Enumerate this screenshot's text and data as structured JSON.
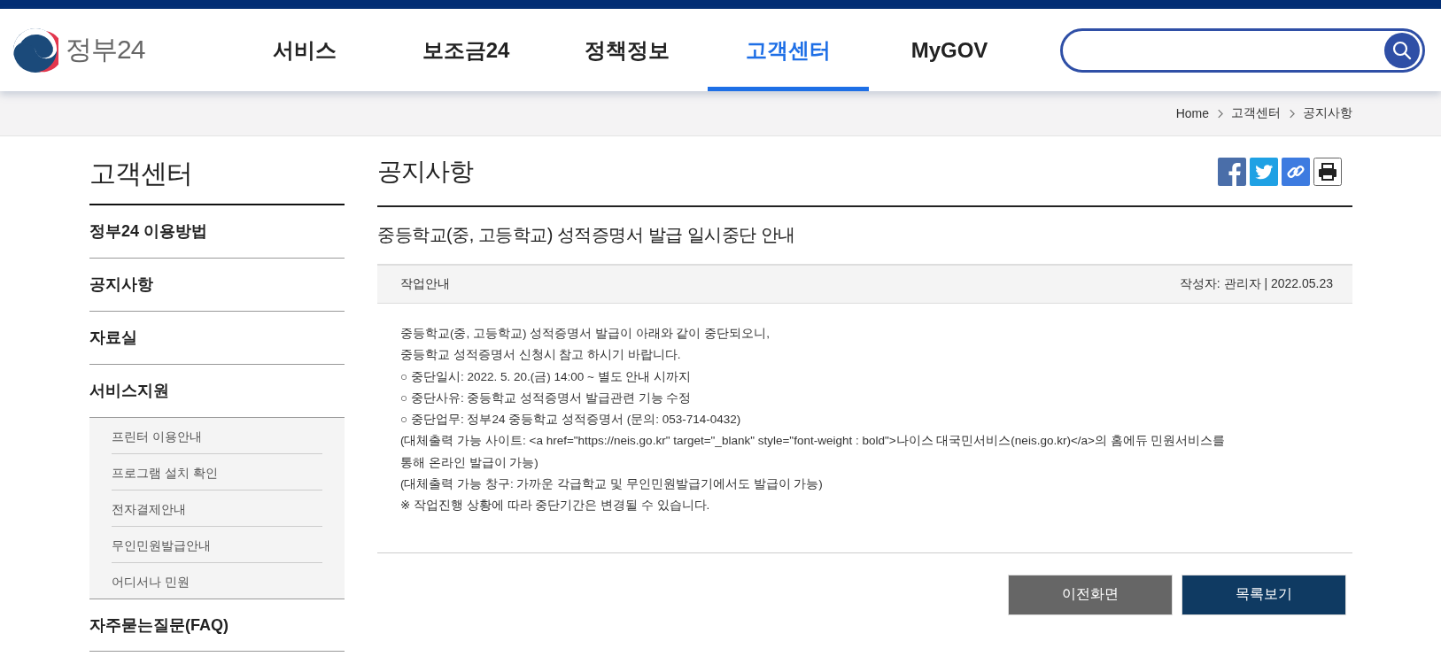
{
  "logo": {
    "text": "정부24"
  },
  "nav": [
    {
      "label": "서비스",
      "selected": false
    },
    {
      "label": "보조금24",
      "selected": false
    },
    {
      "label": "정책정보",
      "selected": false
    },
    {
      "label": "고객센터",
      "selected": true
    },
    {
      "label": "MyGOV",
      "selected": false
    }
  ],
  "breadcrumb": [
    "Home",
    "고객센터",
    "공지사항"
  ],
  "sidebar": {
    "title": "고객센터",
    "items": [
      {
        "label": "정부24 이용방법"
      },
      {
        "label": "공지사항"
      },
      {
        "label": "자료실"
      },
      {
        "label": "서비스지원",
        "children": [
          {
            "label": "프린터 이용안내"
          },
          {
            "label": "프로그램 설치 확인"
          },
          {
            "label": "전자결제안내"
          },
          {
            "label": "무인민원발급안내"
          },
          {
            "label": "어디서나 민원"
          }
        ]
      },
      {
        "label": "자주묻는질문(FAQ)"
      }
    ]
  },
  "page_title": "공지사항",
  "notice": {
    "title": "중등학교(중, 고등학교) 성적증명서 발급 일시중단 안내",
    "category": "작업안내",
    "meta": "작성자: 관리자 | 2022.05.23",
    "body": [
      "중등학교(중, 고등학교) 성적증명서 발급이 아래와 같이 중단되오니,",
      "중등학교 성적증명서 신청시 참고 하시기 바랍니다.",
      "○ 중단일시: 2022. 5. 20.(금) 14:00 ~ 별도 안내 시까지",
      "○ 중단사유: 중등학교 성적증명서 발급관련 기능 수정",
      "○ 중단업무: 정부24 중등학교 성적증명서 (문의: 053-714-0432)",
      "(대체출력 가능 사이트: <a href=\"https://neis.go.kr\" target=\"_blank\" style=\"font-weight : bold\">나이스 대국민서비스(neis.go.kr)</a>의 홈에듀 민원서비스를 통해 온라인 발급이 가능)",
      "(대체출력 가능 창구: 가까운 각급학교 및 무인민원발급기에서도 발급이 가능)",
      "※ 작업진행 상황에 따라 중단기간은 변경될 수 있습니다."
    ]
  },
  "buttons": [
    {
      "label": "이전화면",
      "kind": "secondary"
    },
    {
      "label": "목록보기",
      "kind": "primary"
    }
  ]
}
